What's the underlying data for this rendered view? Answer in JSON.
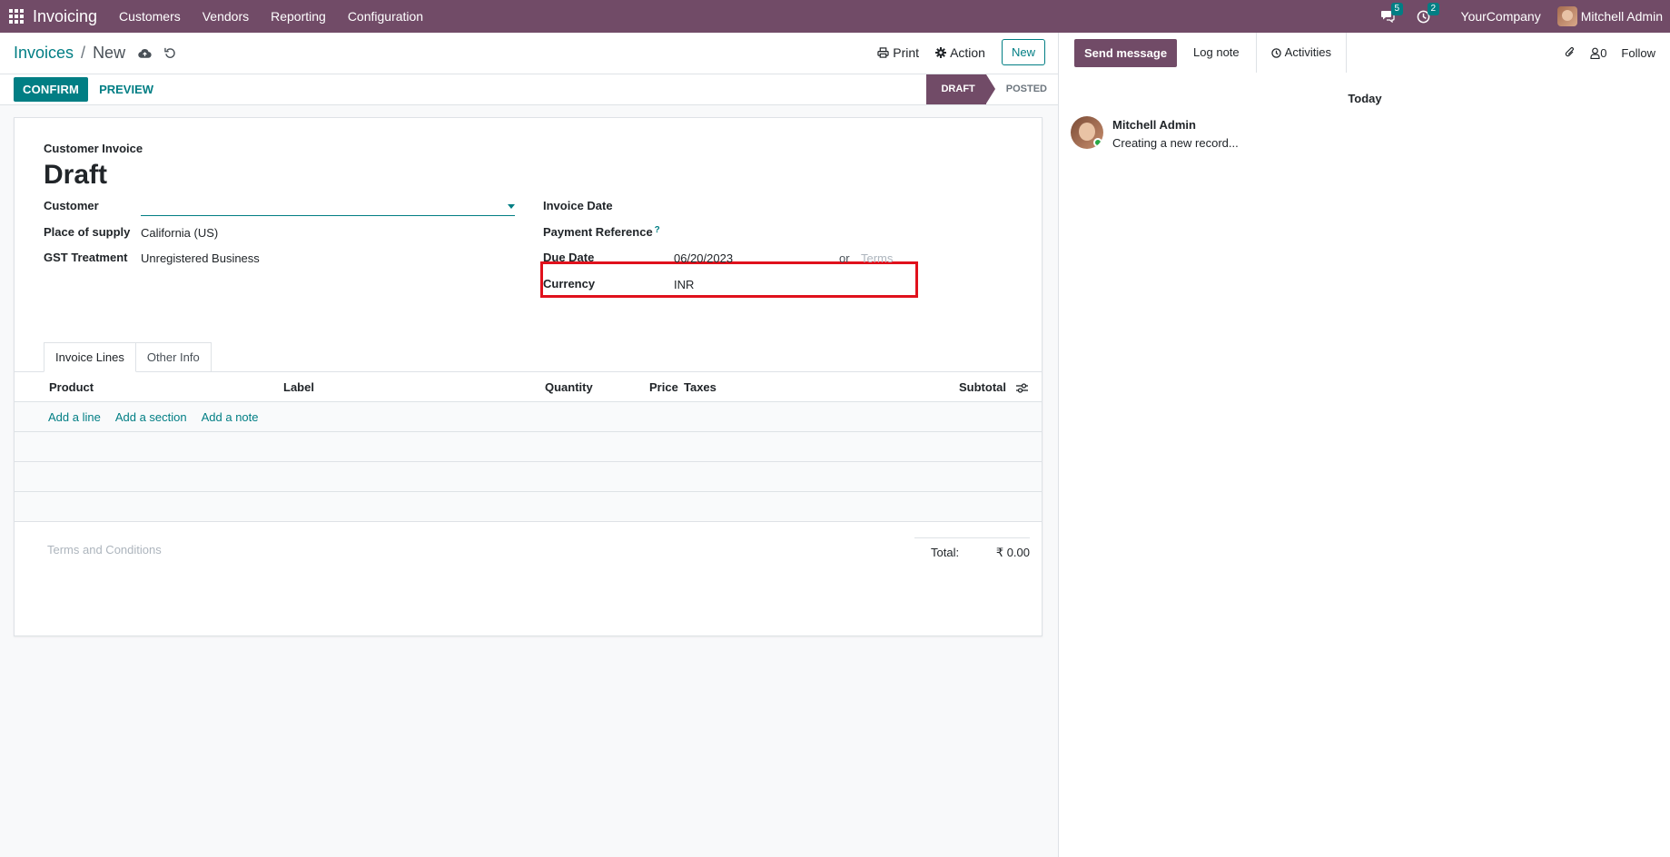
{
  "navbar": {
    "brand": "Invoicing",
    "menu": [
      "Customers",
      "Vendors",
      "Reporting",
      "Configuration"
    ],
    "messages_badge": "5",
    "activities_badge": "2",
    "company": "YourCompany",
    "user": "Mitchell Admin"
  },
  "breadcrumb": {
    "parent": "Invoices",
    "separator": "/",
    "current": "New"
  },
  "toolbar": {
    "print_label": "Print",
    "action_label": "Action",
    "new_label": "New",
    "confirm_label": "CONFIRM",
    "preview_label": "PREVIEW"
  },
  "status": {
    "draft": "DRAFT",
    "posted": "POSTED"
  },
  "form": {
    "subtitle": "Customer Invoice",
    "title": "Draft",
    "customer_label": "Customer",
    "customer_value": "",
    "place_label": "Place of supply",
    "place_value": "California (US)",
    "gst_label": "GST Treatment",
    "gst_value": "Unregistered Business",
    "invoice_date_label": "Invoice Date",
    "payment_ref_label": "Payment Reference",
    "payment_ref_help": "?",
    "due_date_label": "Due Date",
    "due_date_value": "06/20/2023",
    "or_text": "or",
    "terms_placeholder": "Terms",
    "currency_label": "Currency",
    "currency_value": "INR"
  },
  "tabs": [
    "Invoice Lines",
    "Other Info"
  ],
  "table": {
    "headers": {
      "product": "Product",
      "label": "Label",
      "quantity": "Quantity",
      "price": "Price",
      "taxes": "Taxes",
      "subtotal": "Subtotal"
    },
    "add_line": "Add a line",
    "add_section": "Add a section",
    "add_note": "Add a note"
  },
  "footer": {
    "terms_placeholder": "Terms and Conditions",
    "total_label": "Total:",
    "total_value": "₹ 0.00"
  },
  "chatter": {
    "send_message": "Send message",
    "log_note": "Log note",
    "activities": "Activities",
    "followers_count": "0",
    "follow": "Follow",
    "today": "Today",
    "message_author": "Mitchell Admin",
    "message_text": "Creating a new record..."
  },
  "colors": {
    "brand": "#714b67",
    "accent": "#017e84",
    "highlight": "#e0111c"
  }
}
